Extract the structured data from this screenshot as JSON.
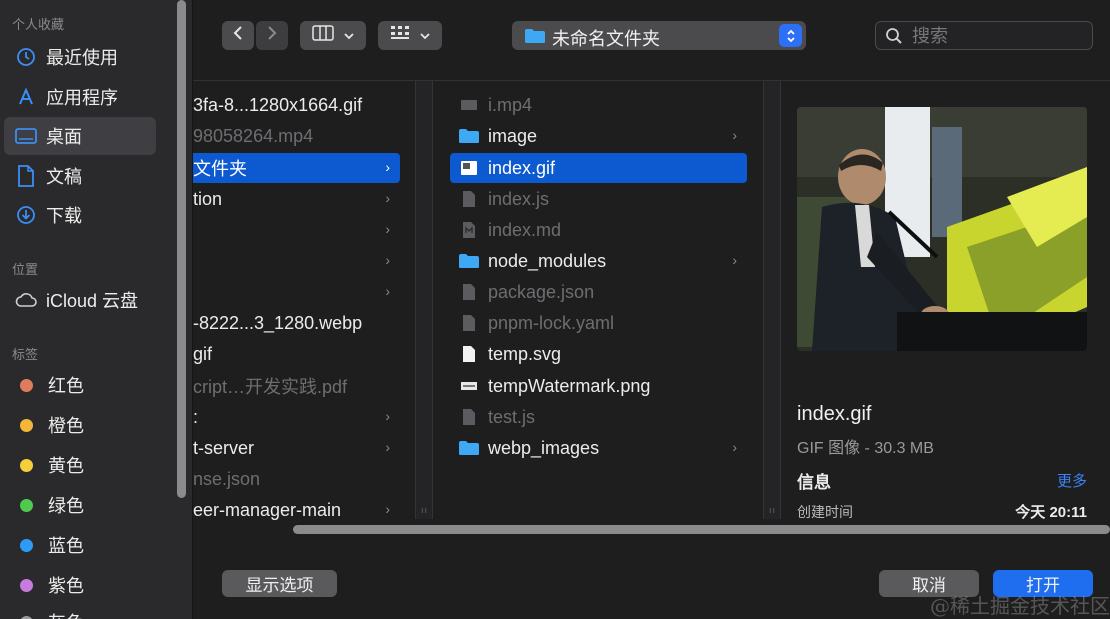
{
  "sidebar": {
    "favorites_header": "个人收藏",
    "favorites": [
      {
        "label": "最近使用",
        "icon": "clock-icon"
      },
      {
        "label": "应用程序",
        "icon": "applications-icon"
      },
      {
        "label": "桌面",
        "icon": "desktop-icon"
      },
      {
        "label": "文稿",
        "icon": "document-icon"
      },
      {
        "label": "下载",
        "icon": "download-icon"
      }
    ],
    "locations_header": "位置",
    "locations": [
      {
        "label": "iCloud 云盘",
        "icon": "cloud-icon"
      }
    ],
    "tags_header": "标签",
    "tags": [
      {
        "label": "红色",
        "color": "#e07c5e"
      },
      {
        "label": "橙色",
        "color": "#f3b63a"
      },
      {
        "label": "黄色",
        "color": "#f4cf3a"
      },
      {
        "label": "绿色",
        "color": "#4fc94f"
      },
      {
        "label": "蓝色",
        "color": "#2e9cf6"
      },
      {
        "label": "紫色",
        "color": "#c77be0"
      },
      {
        "label": "灰色",
        "color": "#9a9a9e"
      }
    ]
  },
  "toolbar": {
    "back_icon": "chevron-left-icon",
    "forward_icon": "chevron-right-icon",
    "view_icon": "columns-view-icon",
    "group_icon": "grid-group-icon",
    "path_label": "未命名文件夹",
    "search_placeholder": "搜索"
  },
  "column1": [
    {
      "name": "3fa-8...1280x1664.gif",
      "dim": false,
      "folder": false
    },
    {
      "name": "98058264.mp4",
      "dim": true,
      "folder": false
    },
    {
      "name": "文件夹",
      "dim": false,
      "folder": true,
      "selected": true
    },
    {
      "name": "tion",
      "dim": false,
      "folder": true
    },
    {
      "name": "",
      "dim": false,
      "folder": true
    },
    {
      "name": "",
      "dim": false,
      "folder": true
    },
    {
      "name": "",
      "dim": false,
      "folder": true
    },
    {
      "name": "-8222...3_1280.webp",
      "dim": false,
      "folder": false
    },
    {
      "name": "gif",
      "dim": false,
      "folder": false
    },
    {
      "name": "cript…开发实践.pdf",
      "dim": true,
      "folder": false
    },
    {
      "name": ":",
      "dim": false,
      "folder": true
    },
    {
      "name": "t-server",
      "dim": false,
      "folder": true
    },
    {
      "name": "nse.json",
      "dim": true,
      "folder": false
    },
    {
      "name": "eer-manager-main",
      "dim": false,
      "folder": true
    }
  ],
  "column2": [
    {
      "name": "i.mp4",
      "dim": true,
      "icon": "video-file-icon"
    },
    {
      "name": "image",
      "dim": false,
      "icon": "folder-icon",
      "folder": true
    },
    {
      "name": "index.gif",
      "dim": false,
      "icon": "image-file-icon",
      "selected": true
    },
    {
      "name": "index.js",
      "dim": true,
      "icon": "js-file-icon"
    },
    {
      "name": "index.md",
      "dim": true,
      "icon": "md-file-icon"
    },
    {
      "name": "node_modules",
      "dim": false,
      "icon": "folder-icon",
      "folder": true
    },
    {
      "name": "package.json",
      "dim": true,
      "icon": "json-file-icon"
    },
    {
      "name": "pnpm-lock.yaml",
      "dim": true,
      "icon": "yaml-file-icon"
    },
    {
      "name": "temp.svg",
      "dim": false,
      "icon": "svg-file-icon"
    },
    {
      "name": "tempWatermark.png",
      "dim": false,
      "icon": "png-file-icon"
    },
    {
      "name": "test.js",
      "dim": true,
      "icon": "js-file-icon"
    },
    {
      "name": "webp_images",
      "dim": false,
      "icon": "folder-icon",
      "folder": true
    }
  ],
  "preview": {
    "name": "index.gif",
    "kind": "GIF 图像 - 30.3 MB",
    "info_label": "信息",
    "more_label": "更多",
    "created_label": "创建时间",
    "created_value": "今天 20:11"
  },
  "bottom": {
    "options_label": "显示选项",
    "cancel_label": "取消",
    "open_label": "打开"
  },
  "watermark": "@稀土掘金技术社区"
}
